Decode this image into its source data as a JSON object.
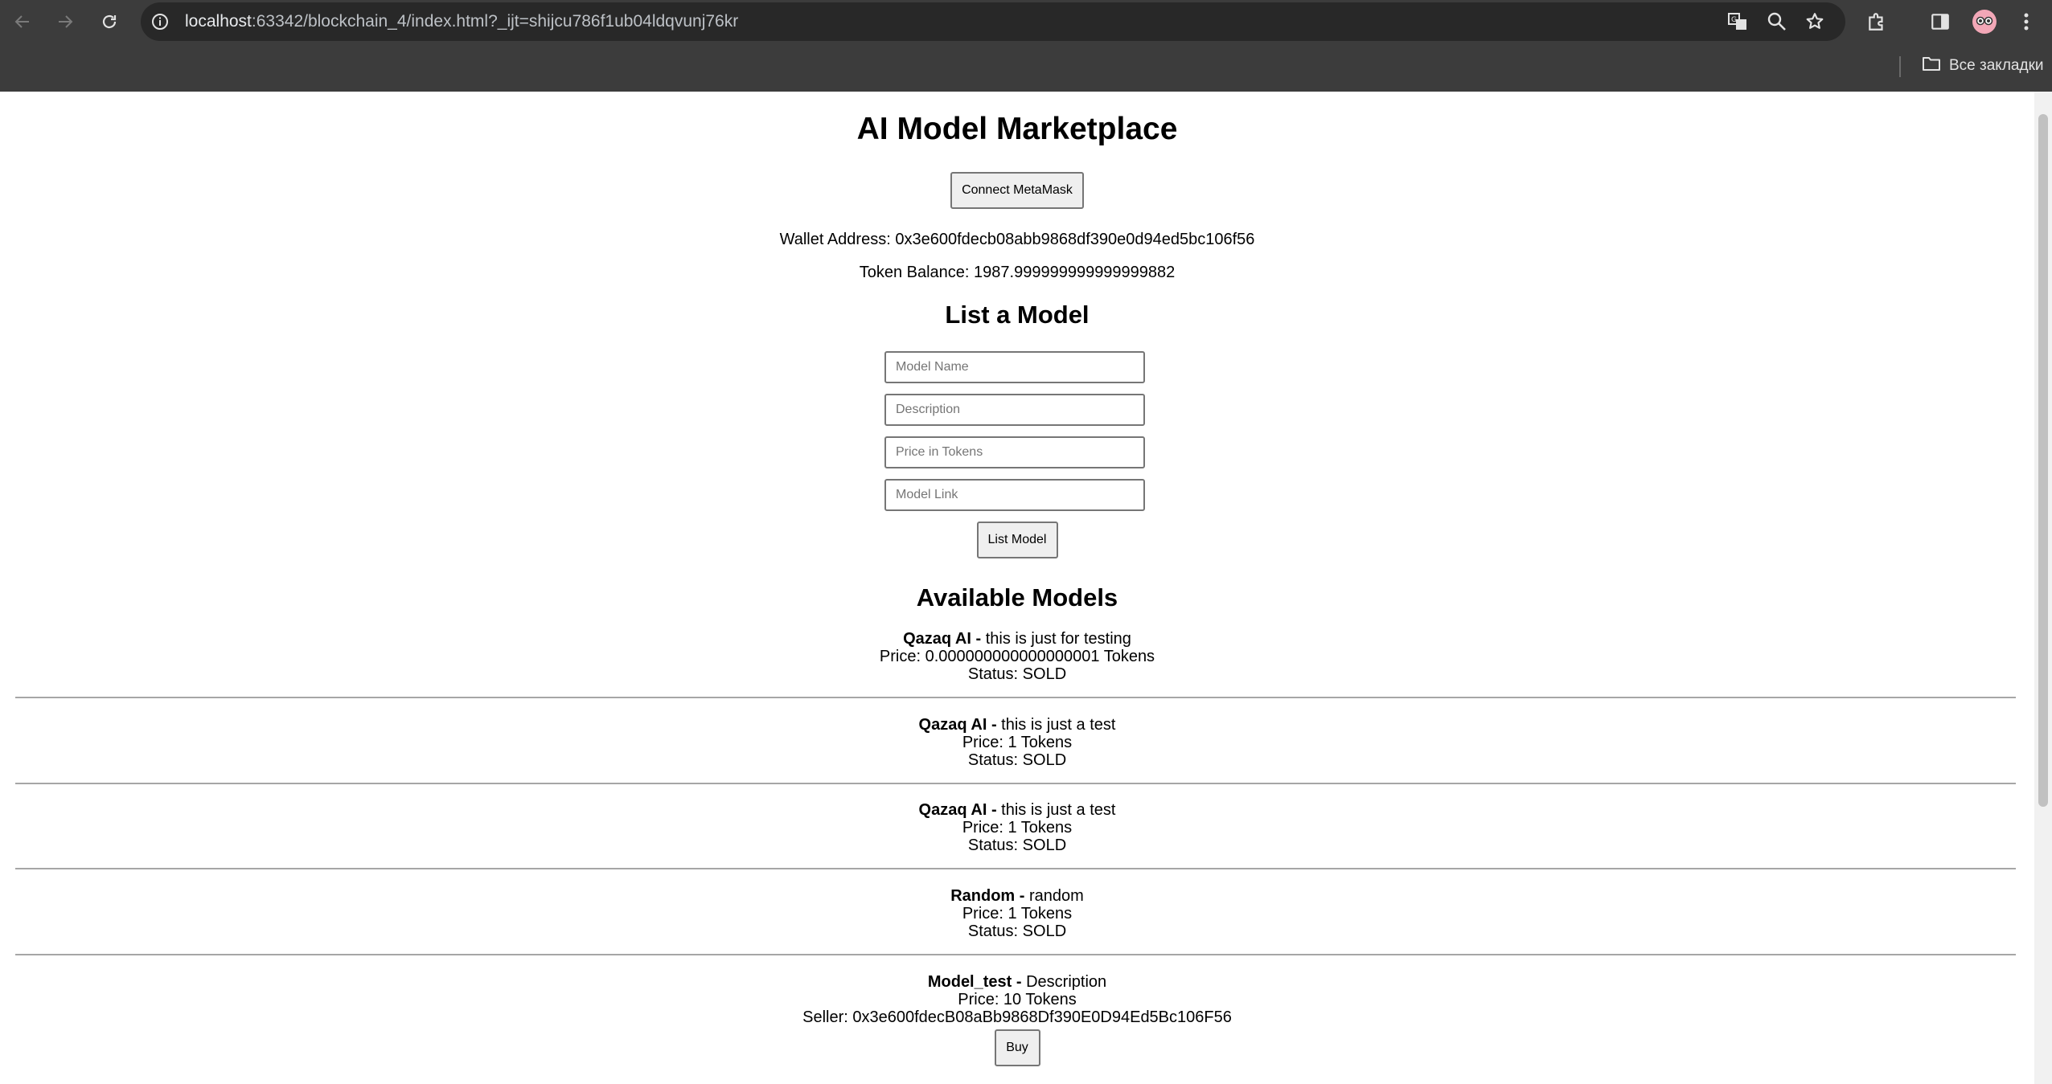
{
  "browser": {
    "url_host": "localhost",
    "url_rest": ":63342/blockchain_4/index.html?_ijt=shijcu786f1ub04ldqvunj76kr",
    "bookmarks_all_label": "Все закладки",
    "icons": [
      "back-arrow-icon",
      "forward-arrow-icon",
      "reload-icon",
      "site-info-icon",
      "translate-icon",
      "zoom-icon",
      "bookmark-star-icon",
      "extensions-icon",
      "side-panel-icon",
      "profile-avatar",
      "more-menu-icon",
      "folder-icon"
    ]
  },
  "page": {
    "title": "AI Model Marketplace",
    "connect_button": "Connect MetaMask",
    "wallet_label": "Wallet Address:",
    "wallet_address": "0x3e600fdecb08abb9868df390e0d94ed5bc106f56",
    "balance_label": "Token Balance:",
    "token_balance": "1987.999999999999999882",
    "list_heading": "List a Model",
    "form": {
      "model_name_placeholder": "Model Name",
      "description_placeholder": "Description",
      "price_placeholder": "Price in Tokens",
      "link_placeholder": "Model Link",
      "submit_label": "List Model"
    },
    "available_heading": "Available Models",
    "models": [
      {
        "name": "Qazaq AI",
        "sep": " - ",
        "description": "this is just for testing",
        "price_line": "Price: 0.000000000000000001 Tokens",
        "status_line": "Status: SOLD"
      },
      {
        "name": "Qazaq AI",
        "sep": " - ",
        "description": "this is just a test",
        "price_line": "Price: 1 Tokens",
        "status_line": "Status: SOLD"
      },
      {
        "name": "Qazaq AI",
        "sep": " - ",
        "description": "this is just a test",
        "price_line": "Price: 1 Tokens",
        "status_line": "Status: SOLD"
      },
      {
        "name": "Random",
        "sep": " - ",
        "description": "random",
        "price_line": "Price: 1 Tokens",
        "status_line": "Status: SOLD"
      },
      {
        "name": "Model_test",
        "sep": " - ",
        "description": "Description",
        "price_line": "Price: 10 Tokens",
        "seller_line": "Seller: 0x3e600fdecB08aBb9868Df390E0D94Ed5Bc106F56",
        "buy_label": "Buy"
      }
    ]
  }
}
